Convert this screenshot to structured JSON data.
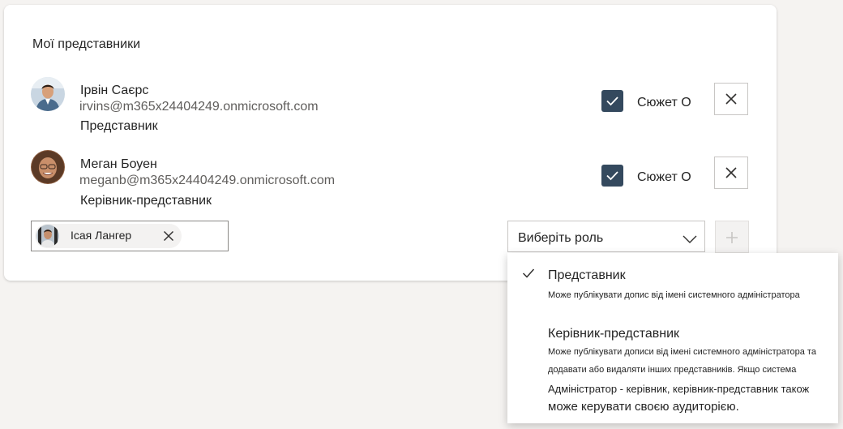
{
  "section": {
    "title": "Мої представники"
  },
  "delegates": [
    {
      "name": "Ірвін Саєрс",
      "email": "irvins@m365x24404249.onmicrosoft.com",
      "role": "Представник",
      "checkbox_label": "Сюжет О",
      "checked": true,
      "avatar_icon": "person-photo"
    },
    {
      "name": "Меган Боуен",
      "email": "meganb@m365x24404249.onmicrosoft.com",
      "role": "Керівник-представник",
      "checkbox_label": "Сюжет О",
      "checked": true,
      "avatar_icon": "person-photo"
    }
  ],
  "add_row": {
    "selected_person": "Ісая Лангер",
    "role_select_value": "Виберіть роль",
    "add_button_icon": "plus-icon"
  },
  "role_dropdown": {
    "options": [
      {
        "title": "Представник",
        "selected": true,
        "description_lines": [
          "Може публікувати допис від імені системного адміністратора"
        ]
      },
      {
        "title": "Керівник-представник",
        "selected": false,
        "description_lines": [
          "Може публікувати дописи від імені системного адміністратора та",
          "додавати або видаляти інших представників. Якщо система",
          "Адміністратор - керівник, керівник-представник також",
          "може керувати своєю аудиторією."
        ]
      }
    ]
  },
  "colors": {
    "checkbox_fill": "#34495e",
    "background": "#f5f3f1",
    "card": "#ffffff"
  }
}
